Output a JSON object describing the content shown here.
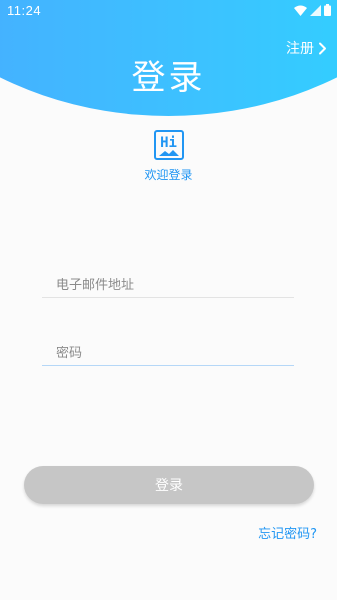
{
  "status_bar": {
    "time": "11:24",
    "icons": [
      "wifi-icon",
      "signal-icon",
      "battery-icon"
    ]
  },
  "header": {
    "title": "登录",
    "register_label": "注册",
    "register_icon": "chevron-right-icon",
    "gradient_colors": [
      "#4aa6ff",
      "#2ad9ff"
    ]
  },
  "logo": {
    "icon_text": "Hi",
    "caption": "欢迎登录",
    "color": "#2196f3"
  },
  "form": {
    "email": {
      "placeholder": "电子邮件地址",
      "value": ""
    },
    "password": {
      "placeholder": "密码",
      "value": ""
    }
  },
  "login_button": {
    "label": "登录",
    "color": "#c6c6c6"
  },
  "forgot_password_label": "忘记密码?"
}
